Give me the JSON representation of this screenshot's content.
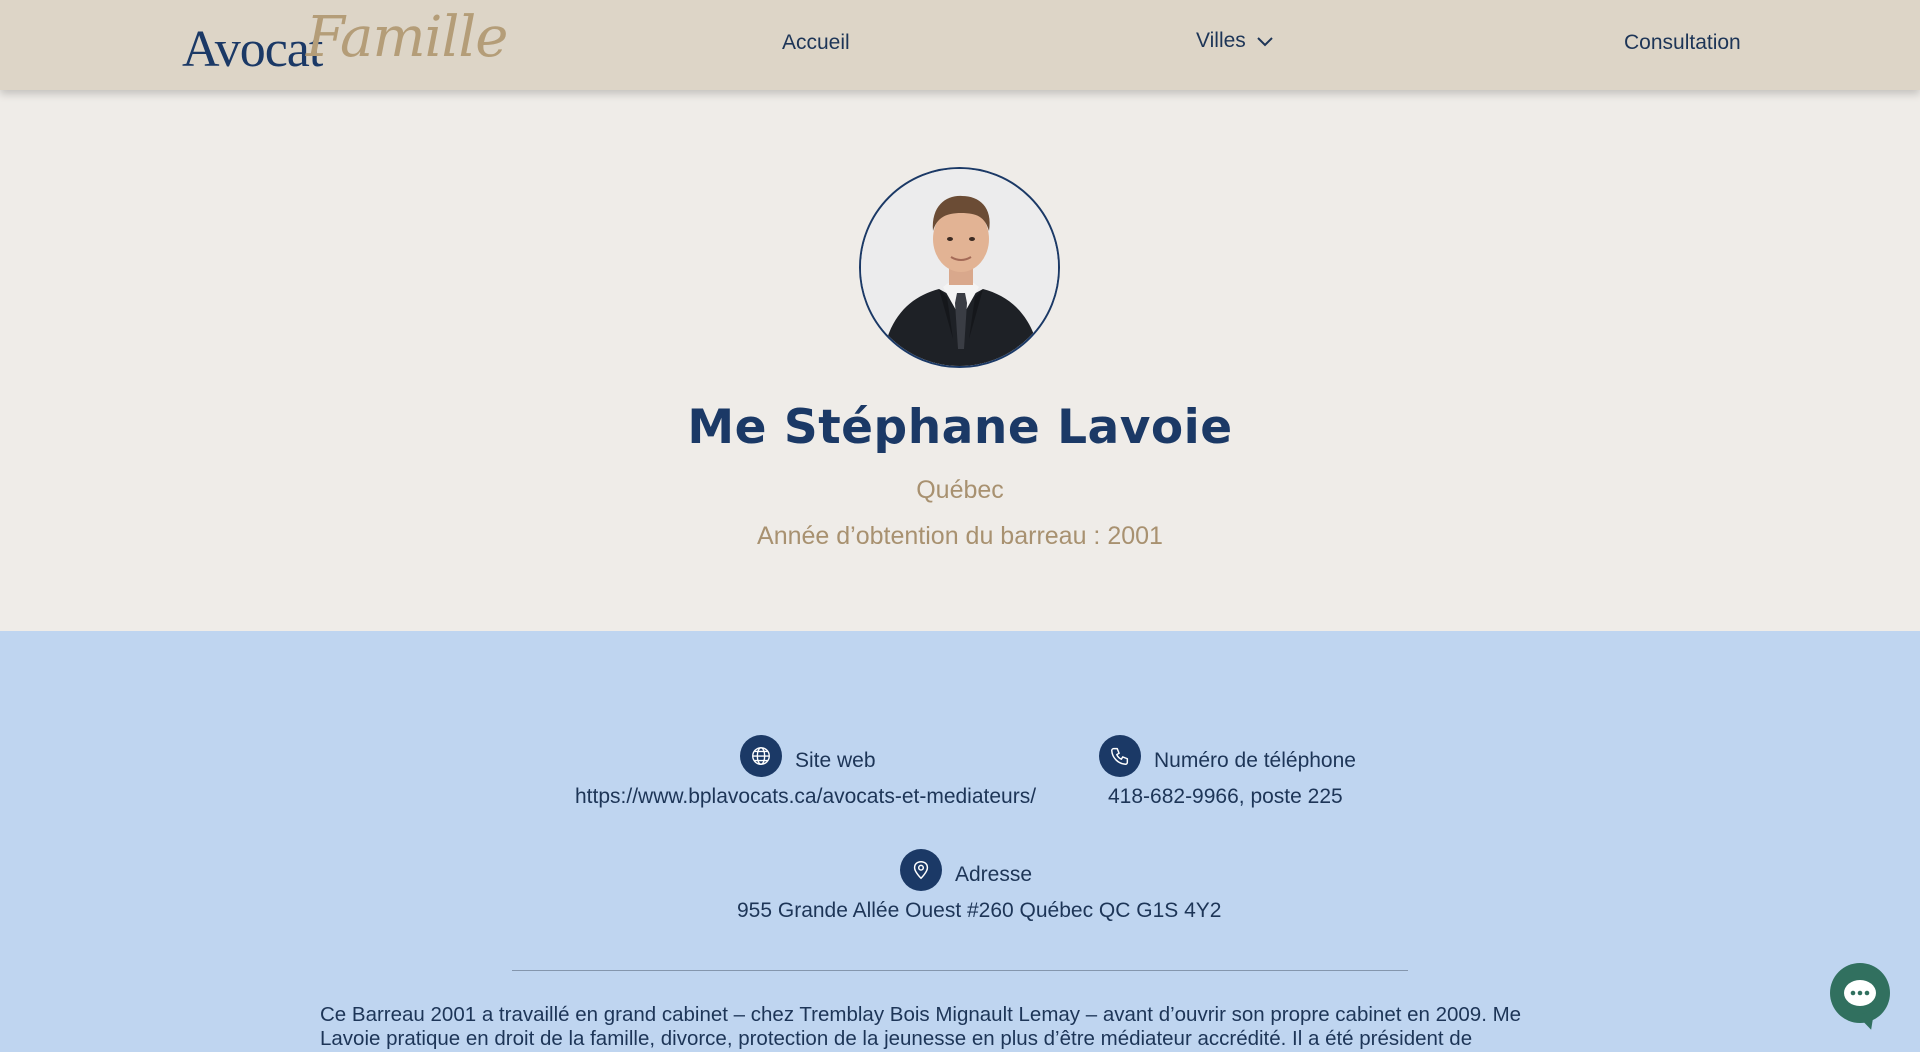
{
  "header": {
    "logo": {
      "main": "Avocat",
      "script": "Famille"
    },
    "nav": {
      "home": "Accueil",
      "cities": "Villes",
      "consultation": "Consultation"
    }
  },
  "profile": {
    "name": "Me Stéphane Lavoie",
    "city": "Québec",
    "bar_year": "Année d’obtention du barreau : 2001"
  },
  "contact": {
    "website": {
      "label": "Site web",
      "value": "https://www.bplavocats.ca/avocats-et-mediateurs/",
      "icon": "globe-icon"
    },
    "phone": {
      "label": "Numéro de téléphone",
      "value": "418-682-9966, poste 225",
      "icon": "phone-icon"
    },
    "address": {
      "label": "Adresse",
      "value": "955 Grande Allée Ouest #260 Québec QC G1S 4Y2",
      "icon": "map-pin-icon"
    }
  },
  "bio": {
    "text": "Ce Barreau 2001 a travaillé en grand cabinet – chez Tremblay Bois Mignault Lemay – avant d’ouvrir son propre cabinet en 2009. Me Lavoie pratique en droit de la famille, divorce, protection de la jeunesse en plus d’être médiateur accrédité. Il a été président de l’Association des"
  },
  "chat": {
    "icon": "chat-bubble-icon"
  },
  "colors": {
    "navy": "#1b3966",
    "gold": "#a89170",
    "header_bg": "#ddd5c7",
    "page_bg": "#efece8",
    "contact_bg": "#bfd5f0",
    "chat_green": "#31705f"
  }
}
